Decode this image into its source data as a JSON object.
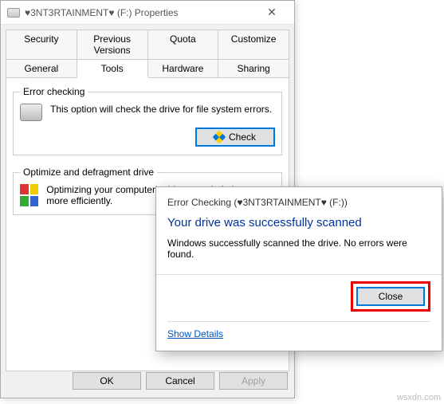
{
  "props": {
    "title": "♥3NT3RTAINMENT♥ (F:) Properties",
    "tabsRow1": [
      "Security",
      "Previous Versions",
      "Quota",
      "Customize"
    ],
    "tabsRow2": [
      "General",
      "Tools",
      "Hardware",
      "Sharing"
    ],
    "errorChecking": {
      "legend": "Error checking",
      "desc": "This option will check the drive for file system errors.",
      "button": "Check"
    },
    "optimize": {
      "legend": "Optimize and defragment drive",
      "desc": "Optimizing your computer's drives can help it run more efficiently."
    },
    "buttons": {
      "ok": "OK",
      "cancel": "Cancel",
      "apply": "Apply"
    }
  },
  "dialog": {
    "title": "Error Checking (♥3NT3RTAINMENT♥ (F:))",
    "headline": "Your drive was successfully scanned",
    "message": "Windows successfully scanned the drive. No errors were found.",
    "close": "Close",
    "showDetails": "Show Details"
  },
  "watermark": "wsxdn.com"
}
